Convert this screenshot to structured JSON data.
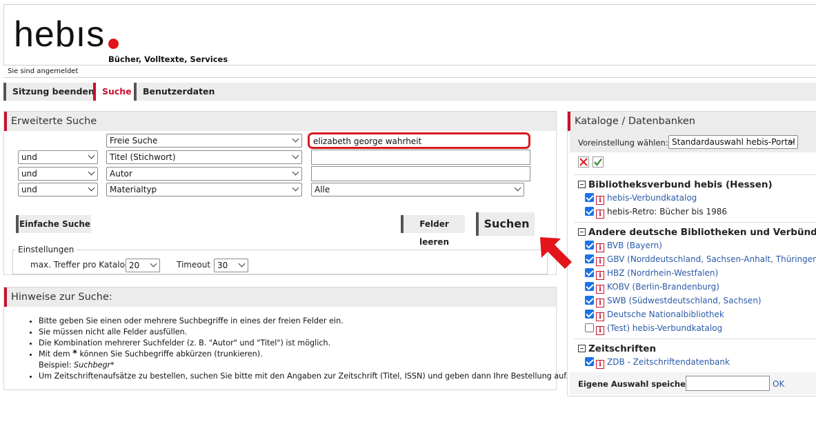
{
  "header": {
    "logo_text": "hebıs",
    "tagline": "Bücher, Volltexte, Services",
    "status": "Sie sind angemeldet",
    "brand_color": "#c8102e"
  },
  "nav": {
    "items": [
      {
        "label": "Sitzung beenden",
        "active": false
      },
      {
        "label": "Suche",
        "active": true
      },
      {
        "label": "Benutzerdaten",
        "active": false
      }
    ]
  },
  "search": {
    "title": "Erweiterte Suche",
    "rows": [
      {
        "operator": "",
        "field": "Freie Suche",
        "value": "elizabeth george wahrheit"
      },
      {
        "operator": "und",
        "field": "Titel (Stichwort)",
        "value": ""
      },
      {
        "operator": "und",
        "field": "Autor",
        "value": ""
      },
      {
        "operator": "und",
        "field": "Materialtyp",
        "value": "Alle"
      }
    ],
    "simple_button": "Einfache Suche",
    "clear_button": "Felder leeren",
    "search_button": "Suchen",
    "settings": {
      "legend": "Einstellungen",
      "max_label": "max. Treffer pro Katalog",
      "max_value": "20",
      "timeout_label": "Timeout",
      "timeout_value": "30"
    }
  },
  "hints": {
    "title": "Hinweise zur Suche:",
    "items": [
      "Bitte geben Sie einen oder mehrere Suchbegriffe in eines der freien Felder ein.",
      "Sie müssen nicht alle Felder ausfüllen.",
      "Die Kombination mehrerer Suchfelder (z. B. \"Autor\" und \"Titel\") ist möglich.",
      "Mit dem",
      "können Sie Suchbegriffe abkürzen (trunkieren).",
      "Beispiel:",
      "Suchbegr*",
      "Um Zeitschriftenaufsätze zu bestellen, suchen Sie bitte mit den Angaben zur Zeitschrift (Titel, ISSN) und geben dann Ihre Bestellung auf."
    ],
    "asterisk": "*"
  },
  "catalogs": {
    "title": "Kataloge / Datenbanken",
    "preset_label": "Voreinstellung wählen:",
    "preset_value": "Standardauswahl hebis-Portal",
    "groups": [
      {
        "name": "Bibliotheksverbund hebis (Hessen)",
        "items": [
          {
            "label": "hebis-Verbundkatalog",
            "checked": true
          },
          {
            "label": "hebis-Retro: Bücher bis 1986",
            "checked": true
          }
        ]
      },
      {
        "name": "Andere deutsche Bibliotheken und Verbünde",
        "items": [
          {
            "label": "BVB (Bayern)",
            "checked": true
          },
          {
            "label": "GBV (Norddeutschland, Sachsen-Anhalt, Thüringen)",
            "checked": true
          },
          {
            "label": "HBZ (Nordrhein-Westfalen)",
            "checked": true
          },
          {
            "label": "KOBV (Berlin-Brandenburg)",
            "checked": true
          },
          {
            "label": "SWB (Südwestdeutschland, Sachsen)",
            "checked": true
          },
          {
            "label": "Deutsche Nationalbibliothek",
            "checked": true
          },
          {
            "label": "(Test) hebis-Verbundkatalog",
            "checked": false
          }
        ]
      },
      {
        "name": "Zeitschriften",
        "items": [
          {
            "label": "ZDB - Zeitschriftendatenbank",
            "checked": true
          }
        ]
      }
    ],
    "save_label": "Eigene Auswahl speichern:",
    "save_value": "",
    "ok_label": "OK"
  }
}
